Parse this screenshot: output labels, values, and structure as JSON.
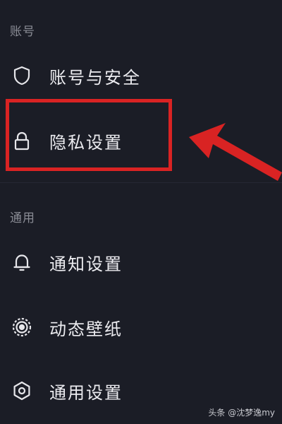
{
  "sections": {
    "account": {
      "header": "账号",
      "items": [
        {
          "label": "账号与安全",
          "icon": "shield-icon"
        },
        {
          "label": "隐私设置",
          "icon": "lock-icon"
        }
      ]
    },
    "general": {
      "header": "通用",
      "items": [
        {
          "label": "通知设置",
          "icon": "bell-icon"
        },
        {
          "label": "动态壁纸",
          "icon": "live-wallpaper-icon"
        },
        {
          "label": "通用设置",
          "icon": "gear-icon"
        }
      ]
    }
  },
  "annotation": {
    "highlight_color": "#d92323",
    "highlighted_item": "隐私设置"
  },
  "watermark": "头条 @沈梦逸my",
  "colors": {
    "background": "#1b1d26",
    "section_header": "#8a8c95",
    "item_text": "#ececf0"
  }
}
